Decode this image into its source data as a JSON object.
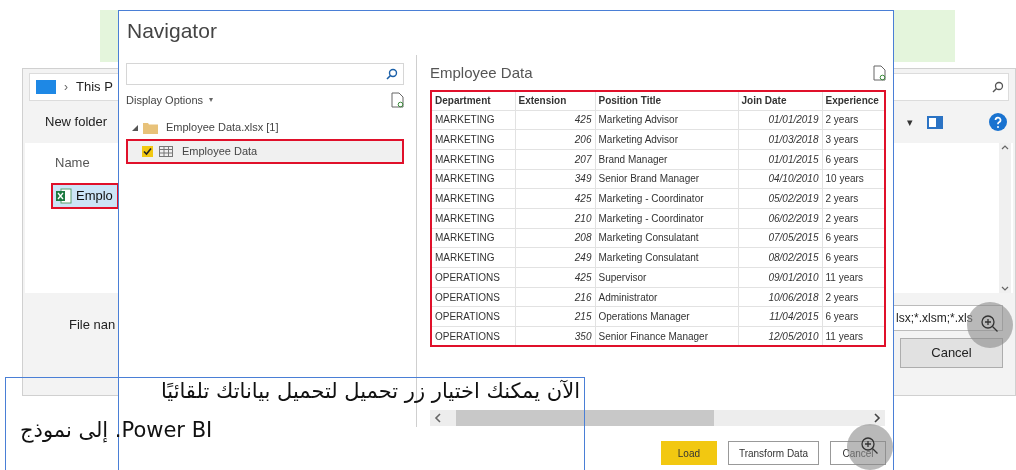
{
  "file_dialog": {
    "breadcrumb_separator": "›",
    "breadcrumb": "This P",
    "new_folder": "New folder",
    "view_caret": "▾",
    "list_header": "Name",
    "items": [
      {
        "name": "Emplo",
        "selected": true
      }
    ],
    "file_name_label": "File nan",
    "file_type": "lsx;*.xlsm;*.xls",
    "cancel": "Cancel"
  },
  "navigator": {
    "title": "Navigator",
    "display_options": "Display Options",
    "display_options_caret": "▾",
    "tree": [
      {
        "label": "Employee Data.xlsx [1]",
        "expanded": true,
        "children": [
          {
            "label": "Employee Data",
            "checked": true,
            "selected": true
          }
        ]
      }
    ],
    "preview": {
      "title": "Employee Data",
      "columns": [
        {
          "label": "Department",
          "kind": "text"
        },
        {
          "label": "Extension",
          "kind": "number"
        },
        {
          "label": "Position Title",
          "kind": "text"
        },
        {
          "label": "Join Date",
          "kind": "date"
        },
        {
          "label": "Experience",
          "kind": "text"
        }
      ],
      "rows": [
        [
          "MARKETING",
          "425",
          "Marketing Advisor",
          "01/01/2019",
          "2 years"
        ],
        [
          "MARKETING",
          "206",
          "Marketing Advisor",
          "01/03/2018",
          "3 years"
        ],
        [
          "MARKETING",
          "207",
          "Brand Manager",
          "01/01/2015",
          "6 years"
        ],
        [
          "MARKETING",
          "349",
          "Senior Brand Manager",
          "04/10/2010",
          "10 years"
        ],
        [
          "MARKETING",
          "425",
          "Marketing - Coordinator",
          "05/02/2019",
          "2 years"
        ],
        [
          "MARKETING",
          "210",
          "Marketing - Coordinator",
          "06/02/2019",
          "2 years"
        ],
        [
          "MARKETING",
          "208",
          "Marketing Consulatant",
          "07/05/2015",
          "6 years"
        ],
        [
          "MARKETING",
          "249",
          "Marketing Consulatant",
          "08/02/2015",
          "6 years"
        ],
        [
          "OPERATIONS",
          "425",
          "Supervisor",
          "09/01/2010",
          "11 years"
        ],
        [
          "OPERATIONS",
          "216",
          "Administrator",
          "10/06/2018",
          "2 years"
        ],
        [
          "OPERATIONS",
          "215",
          "Operations Manager",
          "11/04/2015",
          "6 years"
        ],
        [
          "OPERATIONS",
          "350",
          "Senior Finance Manager",
          "12/05/2010",
          "11 years"
        ]
      ]
    },
    "buttons": [
      {
        "label": "Load",
        "kind": "primary"
      },
      {
        "label": "Transform Data",
        "kind": "default"
      },
      {
        "label": "Cancel",
        "kind": "default"
      }
    ]
  },
  "caption": {
    "lines": [
      {
        "text": "الآن يمكنك اختيار زر تحميل لتحميل بياناتك تلقائيًا",
        "kind": "arabic"
      },
      {
        "text": "إلى نموذج .Power BI",
        "kind": "mixed"
      }
    ]
  }
}
